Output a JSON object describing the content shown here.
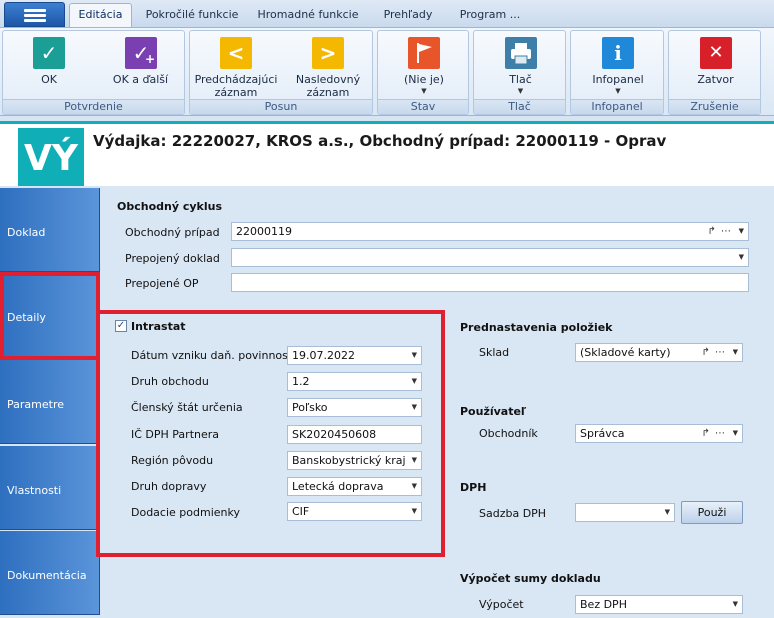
{
  "menu": {
    "icon": "hamburger-icon"
  },
  "tabs": [
    {
      "label": "Editácia",
      "active": true
    },
    {
      "label": "Pokročilé funkcie"
    },
    {
      "label": "Hromadné funkcie"
    },
    {
      "label": "Prehľady"
    },
    {
      "label": "Program ..."
    }
  ],
  "ribbon": {
    "groups": [
      {
        "label": "Potvrdenie"
      },
      {
        "label": "Posun"
      },
      {
        "label": "Stav"
      },
      {
        "label": "Tlač"
      },
      {
        "label": "Infopanel"
      },
      {
        "label": "Zrušenie"
      }
    ],
    "buttons": {
      "ok": {
        "label": "OK",
        "icon": "checkmark-icon",
        "color": "#1a9e95"
      },
      "ok_next": {
        "label": "OK a ďalší",
        "icon": "checkmark-plus-icon",
        "color": "#7a3fb0"
      },
      "prev": {
        "label1": "Predchádzajúci",
        "label2": "záznam",
        "icon": "chevron-left-icon",
        "color": "#f5b800"
      },
      "next": {
        "label1": "Nasledovný",
        "label2": "záznam",
        "icon": "chevron-right-icon",
        "color": "#f5b800"
      },
      "state": {
        "label": "(Nie je)",
        "icon": "flag-icon",
        "color": "#e8552a"
      },
      "print": {
        "label": "Tlač",
        "icon": "printer-icon",
        "color": "#3d7fa8"
      },
      "info": {
        "label": "Infopanel",
        "icon": "info-icon",
        "color": "#1f88d9"
      },
      "close": {
        "label": "Zatvor",
        "icon": "close-icon",
        "color": "#d8202a"
      }
    }
  },
  "header": {
    "logo": "VÝ",
    "title": "Výdajka: 22220027, KROS a.s., Obchodný prípad: 22000119 - Oprav"
  },
  "leftnav": [
    {
      "label": "Doklad"
    },
    {
      "label": "Detaily",
      "active": true
    },
    {
      "label": "Parametre"
    },
    {
      "label": "Vlastnosti"
    },
    {
      "label": "Dokumentácia"
    }
  ],
  "cycle": {
    "title": "Obchodný cyklus",
    "case_label": "Obchodný prípad",
    "case_value": "22000119",
    "linked_doc_label": "Prepojený doklad",
    "linked_doc_value": "",
    "linked_op_label": "Prepojené OP",
    "linked_op_value": ""
  },
  "intrastat": {
    "checkbox_label": "Intrastat",
    "checked": true,
    "fields": [
      {
        "label": "Dátum vzniku daň. povinnosti",
        "value": "19.07.2022",
        "dropdown": true
      },
      {
        "label": "Druh obchodu",
        "value": "1.2",
        "dropdown": true
      },
      {
        "label": "Členský štát určenia",
        "value": "Poľsko",
        "dropdown": true
      },
      {
        "label": "IČ DPH Partnera",
        "value": "SK2020450608",
        "dropdown": false
      },
      {
        "label": "Región pôvodu",
        "value": "Banskobystrický kraj",
        "dropdown": true
      },
      {
        "label": "Druh dopravy",
        "value": "Letecká doprava",
        "dropdown": true
      },
      {
        "label": "Dodacie podmienky",
        "value": "CIF",
        "dropdown": true
      }
    ]
  },
  "presets": {
    "title": "Prednastavenia položiek",
    "label": "Sklad",
    "value": "(Skladové karty)"
  },
  "user": {
    "title": "Používateľ",
    "label": "Obchodník",
    "value": "Správca"
  },
  "vat": {
    "title": "DPH",
    "label": "Sadzba DPH",
    "value": "",
    "button": "Použi"
  },
  "sum": {
    "title": "Výpočet sumy dokladu",
    "label": "Výpočet",
    "value": "Bez DPH"
  },
  "glyphs": {
    "check": "✓",
    "plus": "+",
    "lt": "<",
    "gt": ">",
    "info": "i",
    "x": "✕",
    "caret": "▼",
    "tools": "↱ ⋯",
    "cb": "✓"
  }
}
